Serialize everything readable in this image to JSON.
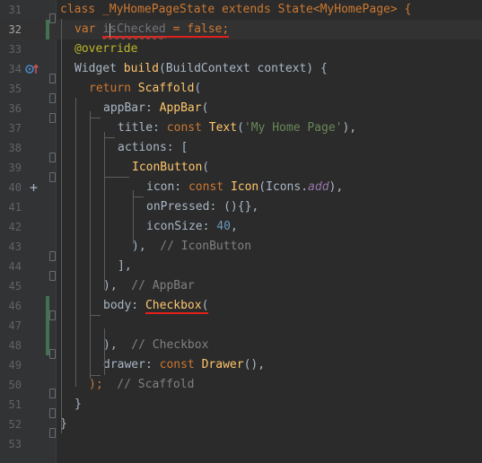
{
  "editor": {
    "lines": [
      {
        "n": "31",
        "t": [
          "class _MyHomePageState extends State<MyHomePage> {"
        ]
      },
      {
        "n": "32",
        "t": [
          "var ",
          "isChecked",
          " = false;"
        ]
      },
      {
        "n": "33",
        "t": [
          "@override"
        ]
      },
      {
        "n": "34",
        "t": [
          "Widget ",
          "build",
          "(BuildContext context) {"
        ]
      },
      {
        "n": "35",
        "t": [
          "return ",
          "Scaffold",
          "("
        ]
      },
      {
        "n": "36",
        "t": [
          "appBar: ",
          "AppBar",
          "("
        ]
      },
      {
        "n": "37",
        "t": [
          "title: ",
          "const ",
          "Text",
          "(",
          "'My Home Page'",
          "),"
        ]
      },
      {
        "n": "38",
        "t": [
          "actions: ["
        ]
      },
      {
        "n": "39",
        "t": [
          "IconButton",
          "("
        ]
      },
      {
        "n": "40",
        "t": [
          "icon: ",
          "const ",
          "Icon",
          "(Icons.",
          "add",
          "),"
        ]
      },
      {
        "n": "41",
        "t": [
          "onPressed: (){},"
        ]
      },
      {
        "n": "42",
        "t": [
          "iconSize: ",
          "40",
          ","
        ]
      },
      {
        "n": "43",
        "t": [
          "),",
          "  // IconButton"
        ]
      },
      {
        "n": "44",
        "t": [
          "],"
        ]
      },
      {
        "n": "45",
        "t": [
          "),",
          "  // AppBar"
        ]
      },
      {
        "n": "46",
        "t": [
          "body: ",
          "Checkbox",
          "("
        ]
      },
      {
        "n": "47",
        "t": [
          ""
        ]
      },
      {
        "n": "48",
        "t": [
          "),",
          "  // Checkbox"
        ]
      },
      {
        "n": "49",
        "t": [
          "drawer: ",
          "const ",
          "Drawer",
          "(),"
        ]
      },
      {
        "n": "50",
        "t": [
          ");",
          "  // Scaffold"
        ]
      },
      {
        "n": "51",
        "t": [
          "}"
        ]
      },
      {
        "n": "52",
        "t": [
          "}"
        ]
      },
      {
        "n": "53",
        "t": [
          ""
        ]
      }
    ]
  },
  "colors": {
    "background": "#2b2b2b",
    "gutter": "#313335",
    "keyword": "#cc7832",
    "function": "#ffc66d",
    "string": "#6a8759",
    "number": "#6897bb",
    "comment": "#808080",
    "annotation": "#bbb529",
    "error_underline": "#e0201a"
  },
  "icons": [
    "override-method-icon",
    "add-icon",
    "fold-marker-icon"
  ]
}
